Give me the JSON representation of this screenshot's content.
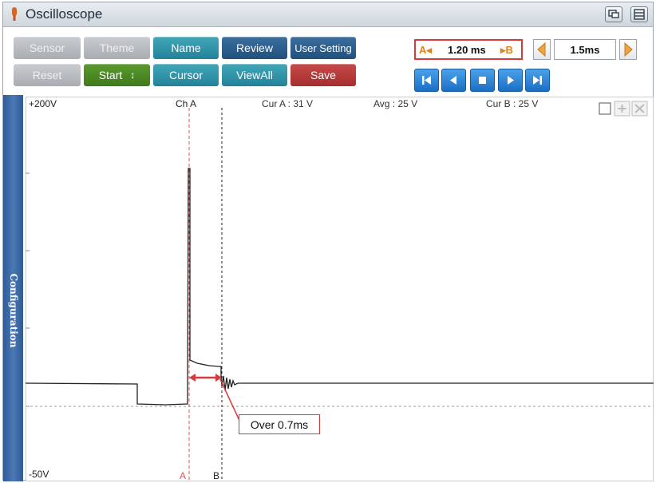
{
  "window": {
    "title": "Oscilloscope"
  },
  "toolbar": {
    "sensor": "Sensor",
    "theme": "Theme",
    "name": "Name",
    "review": "Review",
    "user_setting": "User Setting",
    "reset": "Reset",
    "start": "Start",
    "start_arrow": "↕",
    "cursor": "Cursor",
    "viewall": "ViewAll",
    "save": "Save"
  },
  "cursor_readout": {
    "a_marker": "A◂",
    "value": "1.20 ms",
    "b_marker": "▸B"
  },
  "timebase": {
    "value": "1.5ms"
  },
  "sidebar": {
    "label": "Configuration"
  },
  "scope": {
    "top_voltage": "+200V",
    "bottom_voltage": "-50V",
    "channel": "Ch A",
    "cur_a": "Cur A : 31 V",
    "avg": "Avg : 25 V",
    "cur_b": "Cur B : 25 V",
    "cursor_a_label": "A",
    "cursor_b_label": "B",
    "annotation": "Over 0.7ms"
  },
  "colors": {
    "accent_red": "#d63a3a",
    "teal": "#2a8fa6",
    "navy": "#2a5a8a",
    "green": "#4a8a26",
    "trace": "#222222"
  },
  "icons": [
    "app-icon",
    "window-restore-icon",
    "menu-icon",
    "arrow-left-icon",
    "arrow-right-icon",
    "skip-start-icon",
    "step-back-icon",
    "stop-icon",
    "play-icon",
    "skip-end-icon",
    "checkbox-icon",
    "zoom-in-icon",
    "zoom-out-icon"
  ]
}
